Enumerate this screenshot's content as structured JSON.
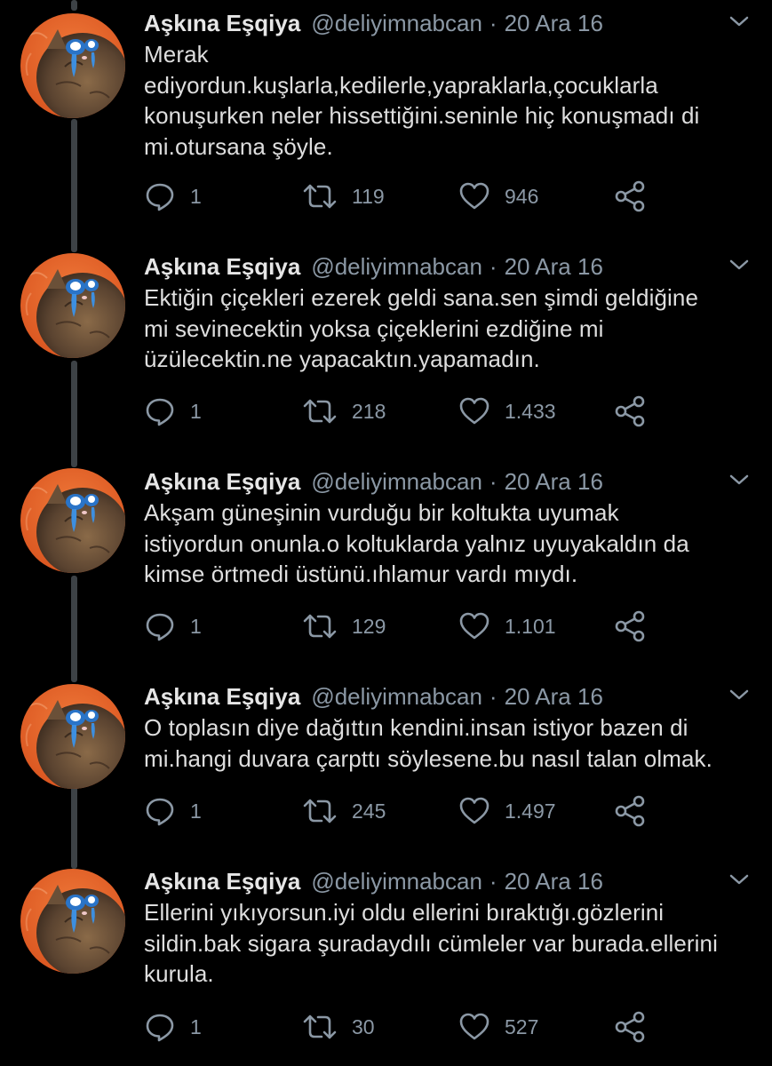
{
  "colors": {
    "background": "#000000",
    "text": "#dedede",
    "secondary": "#8b98a5",
    "thread_line": "#3d4246",
    "avatar_bg": "#e8672c"
  },
  "icons": {
    "reply": "reply-icon",
    "retweet": "retweet-icon",
    "like": "heart-icon",
    "share": "share-icon",
    "more": "chevron-down-icon"
  },
  "tweets": [
    {
      "name": "Aşkına Eşqiya",
      "handle": "@deliyimnabcan",
      "separator": "·",
      "date": "20 Ara 16",
      "lines": [
        "Merak",
        "ediyordun.kuşlarla,kedilerle,yapraklarla,çocuklarla",
        "konuşurken neler hissettiğini.seninle hiç konuşmadı di",
        "mi.otursana şöyle."
      ],
      "replies": "1",
      "retweets": "119",
      "likes": "946"
    },
    {
      "name": "Aşkına Eşqiya",
      "handle": "@deliyimnabcan",
      "separator": "·",
      "date": "20 Ara 16",
      "lines": [
        "Ektiğin çiçekleri ezerek geldi sana.sen şimdi geldiğine",
        "mi sevinecektin yoksa çiçeklerini ezdiğine mi",
        "üzülecektin.ne yapacaktın.yapamadın."
      ],
      "replies": "1",
      "retweets": "218",
      "likes": "1.433"
    },
    {
      "name": "Aşkına Eşqiya",
      "handle": "@deliyimnabcan",
      "separator": "·",
      "date": "20 Ara 16",
      "lines": [
        "Akşam güneşinin vurduğu bir koltukta uyumak",
        "istiyordun onunla.o koltuklarda yalnız uyuyakaldın da",
        "kimse örtmedi üstünü.ıhlamur vardı mıydı."
      ],
      "replies": "1",
      "retweets": "129",
      "likes": "1.101"
    },
    {
      "name": "Aşkına Eşqiya",
      "handle": "@deliyimnabcan",
      "separator": "·",
      "date": "20 Ara 16",
      "lines": [
        "O toplasın diye dağıttın kendini.insan istiyor bazen di",
        "mi.hangi duvara çarpttı söylesene.bu nasıl talan olmak."
      ],
      "replies": "1",
      "retweets": "245",
      "likes": "1.497"
    },
    {
      "name": "Aşkına Eşqiya",
      "handle": "@deliyimnabcan",
      "separator": "·",
      "date": "20 Ara 16",
      "lines": [
        "Ellerini yıkıyorsun.iyi oldu ellerini bıraktığı.gözlerini",
        "sildin.bak sigara şuradaydılı cümleler var burada.ellerini",
        "kurula."
      ],
      "replies": "1",
      "retweets": "30",
      "likes": "527"
    }
  ]
}
